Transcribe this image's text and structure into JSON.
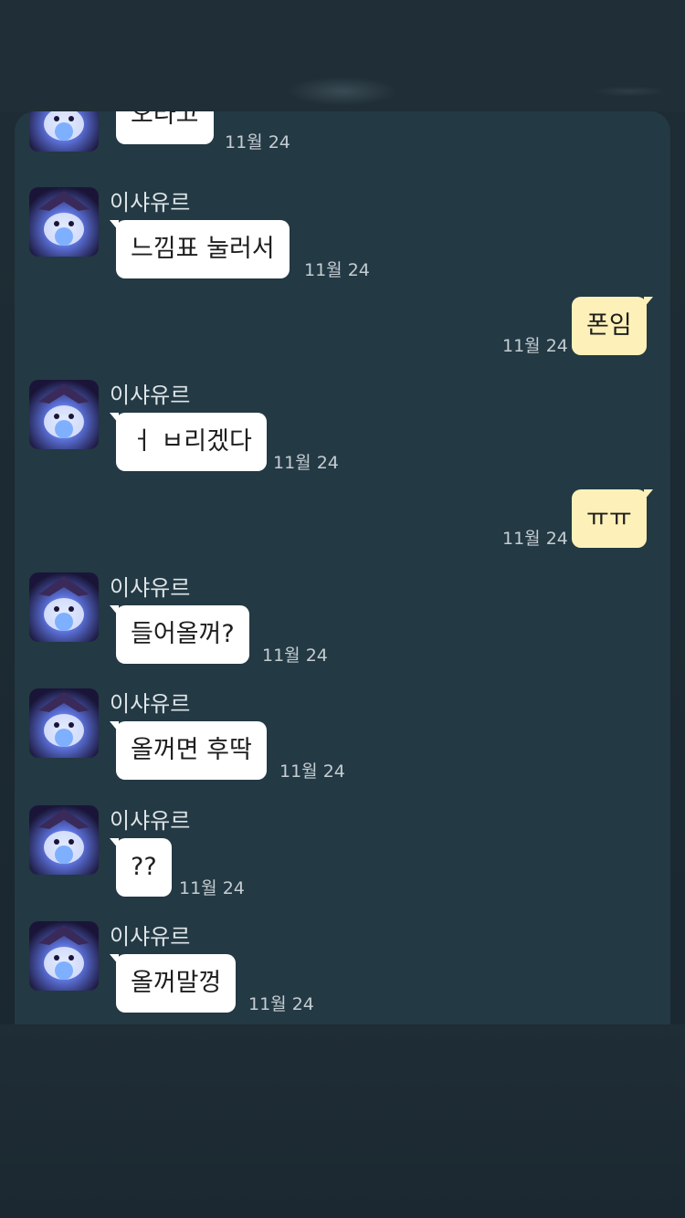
{
  "messages": [
    {
      "side": "in",
      "sender": "",
      "text": "오라고",
      "time": "11월 24",
      "show_avatar": true
    },
    {
      "side": "in",
      "sender": "이샤유르",
      "text": "느낌표 눌러서",
      "time": "11월 24",
      "show_avatar": true
    },
    {
      "side": "out",
      "sender": "",
      "text": "폰임",
      "time": "11월 24",
      "show_avatar": false
    },
    {
      "side": "in",
      "sender": "이샤유르",
      "text": "ㅓ ㅂ리겠다",
      "time": "11월 24",
      "show_avatar": true
    },
    {
      "side": "out",
      "sender": "",
      "text": "ㅠㅠ",
      "time": "11월 24",
      "show_avatar": false
    },
    {
      "side": "in",
      "sender": "이샤유르",
      "text": "들어올꺼?",
      "time": "11월 24",
      "show_avatar": true
    },
    {
      "side": "in",
      "sender": "이샤유르",
      "text": "올꺼면 후딱",
      "time": "11월 24",
      "show_avatar": true
    },
    {
      "side": "in",
      "sender": "이샤유르",
      "text": "??",
      "time": "11월 24",
      "show_avatar": true
    },
    {
      "side": "in",
      "sender": "이샤유르",
      "text": "올꺼말껑",
      "time": "11월 24",
      "show_avatar": true
    }
  ],
  "colors": {
    "panel_bg": "#233944",
    "incoming_bubble": "#ffffff",
    "outgoing_bubble": "#fdf1b9",
    "timestamp": "#c5cdd2"
  },
  "icons": {
    "avatar": "poro-avatar-icon"
  }
}
